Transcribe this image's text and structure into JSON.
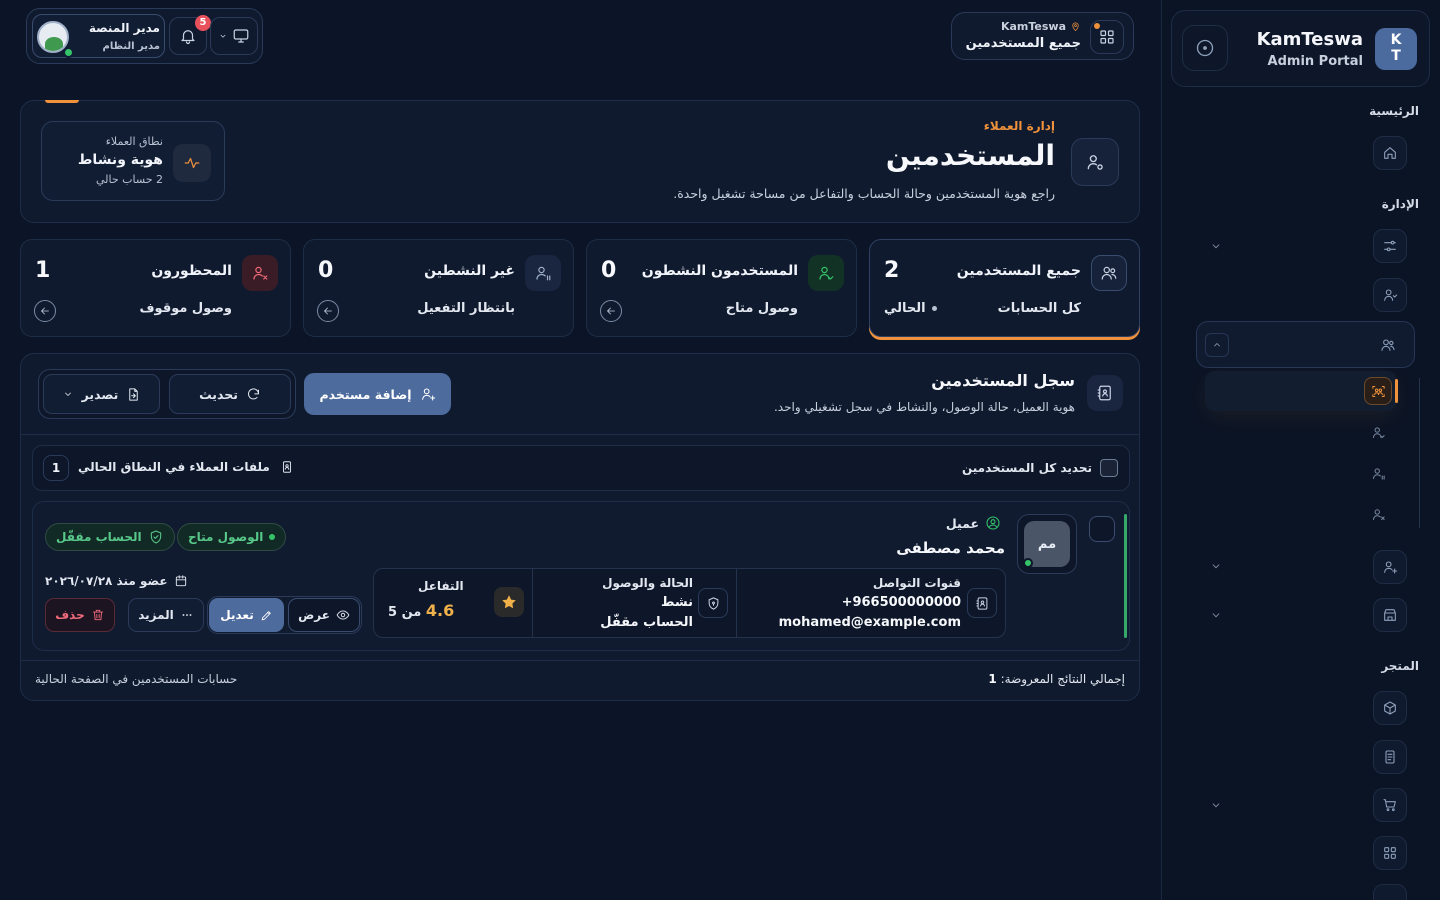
{
  "sidebar": {
    "brand_logo": "K\nT",
    "brand_logo_top": "K",
    "brand_logo_bottom": "T",
    "brand_title": "KamTeswa",
    "brand_subtitle": "Admin Portal",
    "sections": {
      "home": "الرئيسية",
      "management": "الإدارة",
      "store": "المتجر"
    },
    "icons": {
      "toggle": "target-icon",
      "home": "home-icon",
      "settings": "sliders-icon",
      "users": "user-icon",
      "user_group": "users-icon",
      "active_sub": "users-scan-icon",
      "sub_user": "user-icon",
      "sub_pending": "user-pause-icon",
      "sub_blocked": "user-x-icon",
      "add_user": "user-plus-icon",
      "building": "building-icon",
      "package": "package-icon",
      "document": "file-icon",
      "cart": "cart-icon",
      "grid": "grid-icon"
    }
  },
  "header": {
    "workspace": "KamTeswa",
    "page_title": "جميع المستخدمين",
    "user_name": "مدير المنصة",
    "user_role": "مدير النظام",
    "notifications_count": "5"
  },
  "hero": {
    "eyebrow": "إدارة العملاء",
    "title": "المستخدمين",
    "description": "راجع هوية المستخدمين وحالة الحساب والتفاعل من مساحة تشغيل واحدة.",
    "scope_label": "نطاق العملاء",
    "scope_value": "هوية ونشاط",
    "scope_count": "2 حساب حالي"
  },
  "stats": [
    {
      "title": "جميع المستخدمين",
      "value": "2",
      "sub": "كل الحسابات",
      "current": "الحالي"
    },
    {
      "title": "المستخدمون النشطون",
      "value": "0",
      "sub": "وصول متاح"
    },
    {
      "title": "غير النشطين",
      "value": "0",
      "sub": "بانتظار التفعيل"
    },
    {
      "title": "المحظورون",
      "value": "1",
      "sub": "وصول موقوف"
    }
  ],
  "registry": {
    "title": "سجل المستخدمين",
    "description": "هوية العميل، حالة الوصول، والنشاط في سجل تشغيلي واحد.",
    "add_label": "إضافة مستخدم",
    "refresh_label": "تحديث",
    "export_label": "تصدير",
    "select_all_label": "تحديد كل المستخدمين",
    "files_label": "ملفات العملاء في النطاق الحالي",
    "files_count": "1",
    "footer_total_label": "إجمالي النتائج المعروضة:",
    "footer_total_value": "1",
    "footer_note": "حسابات المستخدمين في الصفحة الحالية"
  },
  "users": [
    {
      "initials": "مم",
      "type": "عميل",
      "name": "محمد مصطفى",
      "badge_access": "الوصول متاح",
      "badge_locked": "الحساب مقفّل",
      "contact_title": "قنوات التواصل",
      "phone": "+966500000000",
      "email": "mohamed@example.com",
      "status_title": "الحالة والوصول",
      "status": "نشط",
      "account": "الحساب مقفّل",
      "engagement_title": "التفاعل",
      "rating": "4.6",
      "rating_suffix": "من 5",
      "member_since": "عضو منذ ٢٠٢٦/٠٧/٢٨",
      "view_label": "عرض",
      "edit_label": "تعديل",
      "more_label": "المزيد",
      "delete_label": "حذف"
    }
  ],
  "colors": {
    "background": "#0c1527",
    "accent": "#f0923c",
    "primary": "#4d6b9c",
    "success": "#35c46a",
    "danger": "#e8505b"
  }
}
